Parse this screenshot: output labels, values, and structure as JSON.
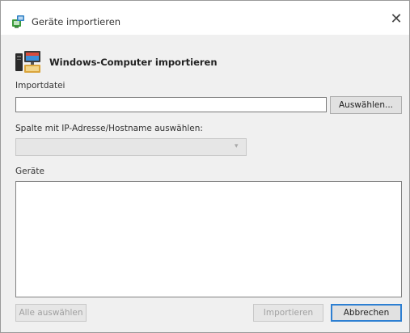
{
  "window": {
    "title": "Geräte importieren",
    "close_glyph": "✕"
  },
  "header": {
    "heading": "Windows-Computer importieren",
    "icon": "computer-import-icon"
  },
  "import_file": {
    "label": "Importdatei",
    "value": "",
    "browse_label": "Auswählen..."
  },
  "column_select": {
    "label": "Spalte mit IP-Adresse/Hostname auswählen:",
    "selected": ""
  },
  "devices": {
    "label": "Geräte",
    "items": []
  },
  "footer": {
    "select_all_label": "Alle auswählen",
    "import_label": "Importieren",
    "cancel_label": "Abbrechen"
  },
  "colors": {
    "content_bg": "#f0f0f0",
    "default_button_border": "#2d7fd2",
    "app_icon_green": "#3d9b3d"
  }
}
